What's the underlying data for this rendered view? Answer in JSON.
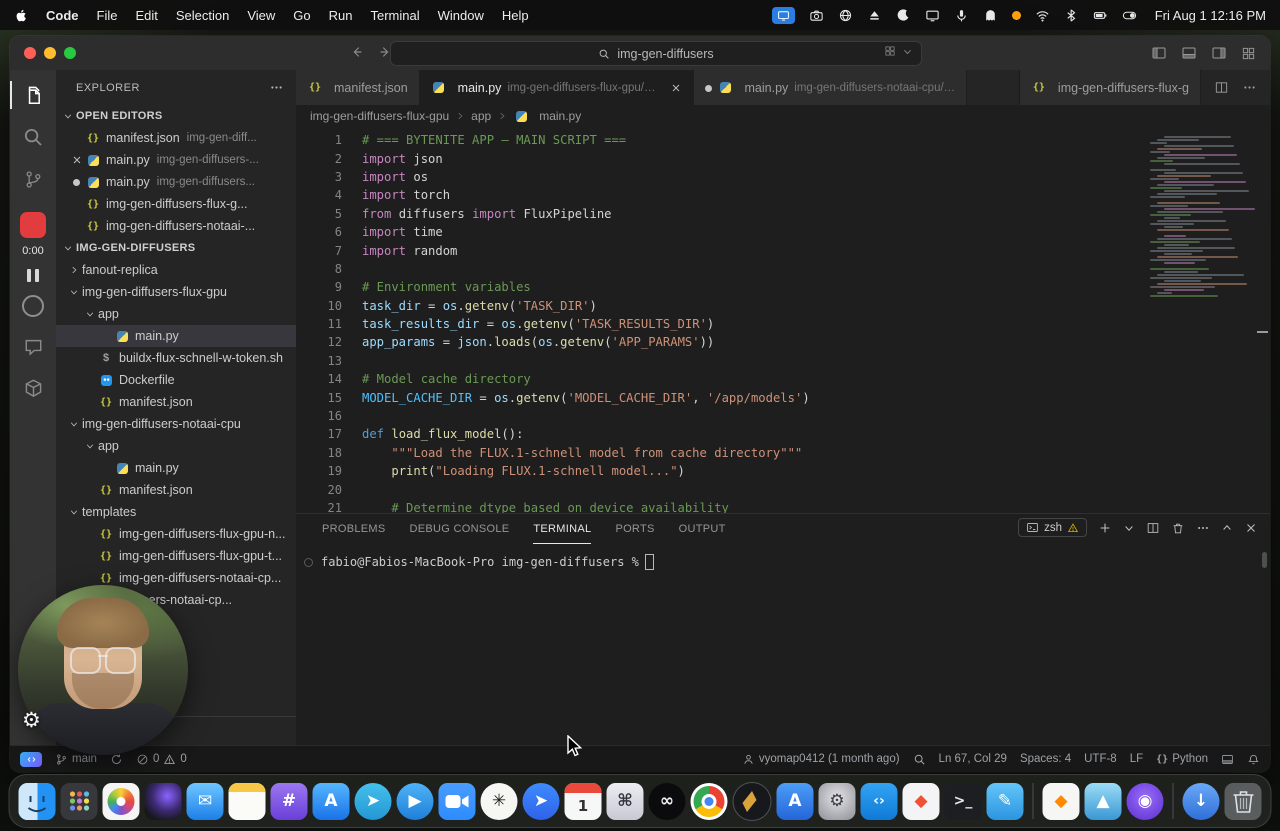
{
  "menubar": {
    "app_name": "Code",
    "menus": [
      "File",
      "Edit",
      "Selection",
      "View",
      "Go",
      "Run",
      "Terminal",
      "Window",
      "Help"
    ],
    "status_icons": [
      "screen-mirroring",
      "camera",
      "globe",
      "eject",
      "moon",
      "display",
      "mic",
      "ghost",
      "record-dot",
      "wifi",
      "bluetooth",
      "battery",
      "toggle"
    ],
    "clock": "Fri Aug 1 12:16 PM"
  },
  "titlebar": {
    "search_value": "img-gen-diffusers"
  },
  "recorder": {
    "time": "0:00"
  },
  "sidebar": {
    "title": "EXPLORER",
    "open_editors_label": "OPEN EDITORS",
    "open_editors": [
      {
        "icon": "json",
        "name": "manifest.json",
        "detail": "img-gen-diff...",
        "indicator": ""
      },
      {
        "icon": "python",
        "name": "main.py",
        "detail": "img-gen-diffusers-...",
        "indicator": "close"
      },
      {
        "icon": "python",
        "name": "main.py",
        "detail": "img-gen-diffusers...",
        "indicator": "dot"
      },
      {
        "icon": "json",
        "name": "img-gen-diffusers-flux-g...",
        "detail": "",
        "indicator": ""
      },
      {
        "icon": "json",
        "name": "img-gen-diffusers-notaai-...",
        "detail": "",
        "indicator": ""
      }
    ],
    "project_label": "IMG-GEN-DIFFUSERS",
    "tree": [
      {
        "indent": 0,
        "chevron": "collapsed",
        "icon": "",
        "name": "fanout-replica"
      },
      {
        "indent": 0,
        "chevron": "expanded",
        "icon": "",
        "name": "img-gen-diffusers-flux-gpu"
      },
      {
        "indent": 1,
        "chevron": "expanded",
        "icon": "",
        "name": "app"
      },
      {
        "indent": 2,
        "chevron": "",
        "icon": "python",
        "name": "main.py",
        "selected": true
      },
      {
        "indent": 1,
        "chevron": "",
        "icon": "shell",
        "name": "buildx-flux-schnell-w-token.sh"
      },
      {
        "indent": 1,
        "chevron": "",
        "icon": "docker",
        "name": "Dockerfile"
      },
      {
        "indent": 1,
        "chevron": "",
        "icon": "json",
        "name": "manifest.json"
      },
      {
        "indent": 0,
        "chevron": "expanded",
        "icon": "",
        "name": "img-gen-diffusers-notaai-cpu"
      },
      {
        "indent": 1,
        "chevron": "expanded",
        "icon": "",
        "name": "app"
      },
      {
        "indent": 2,
        "chevron": "",
        "icon": "python",
        "name": "main.py"
      },
      {
        "indent": 1,
        "chevron": "",
        "icon": "json",
        "name": "manifest.json"
      },
      {
        "indent": 0,
        "chevron": "expanded",
        "icon": "",
        "name": "templates"
      },
      {
        "indent": 1,
        "chevron": "",
        "icon": "json",
        "name": "img-gen-diffusers-flux-gpu-n..."
      },
      {
        "indent": 1,
        "chevron": "",
        "icon": "json",
        "name": "img-gen-diffusers-flux-gpu-t..."
      },
      {
        "indent": 1,
        "chevron": "",
        "icon": "json",
        "name": "img-gen-diffusers-notaai-cp..."
      },
      {
        "indent": 1,
        "chevron": "",
        "icon": "json",
        "name": "diffusers-notaai-cp..."
      }
    ]
  },
  "editor": {
    "tabs": [
      {
        "icon": "json",
        "title": "manifest.json",
        "state": "inactive",
        "close": false,
        "dirty": false
      },
      {
        "icon": "python",
        "title": "main.py",
        "detail": "img-gen-diffusers-flux-gpu/…",
        "state": "active",
        "close": true,
        "dirty": false
      },
      {
        "icon": "python",
        "title": "main.py",
        "detail": "img-gen-diffusers-notaai-cpu/…",
        "state": "inactive",
        "close": false,
        "dirty": true
      }
    ],
    "right_tab": {
      "icon": "json",
      "title": "img-gen-diffusers-flux-g"
    },
    "breadcrumb": [
      "img-gen-diffusers-flux-gpu",
      "app",
      "main.py"
    ],
    "code_lines": [
      {
        "n": "1",
        "s": [
          [
            "# === BYTENITE APP — MAIN SCRIPT ===",
            "c"
          ]
        ]
      },
      {
        "n": "2",
        "s": [
          [
            "import",
            "k"
          ],
          [
            " json",
            "p"
          ]
        ]
      },
      {
        "n": "3",
        "s": [
          [
            "import",
            "k"
          ],
          [
            " os",
            "p"
          ]
        ]
      },
      {
        "n": "4",
        "s": [
          [
            "import",
            "k"
          ],
          [
            " torch",
            "p"
          ]
        ]
      },
      {
        "n": "5",
        "s": [
          [
            "from",
            "k"
          ],
          [
            " diffusers ",
            "p"
          ],
          [
            "import",
            "k"
          ],
          [
            " FluxPipeline",
            "p"
          ]
        ]
      },
      {
        "n": "6",
        "s": [
          [
            "import",
            "k"
          ],
          [
            " time",
            "p"
          ]
        ]
      },
      {
        "n": "7",
        "s": [
          [
            "import",
            "k"
          ],
          [
            " random",
            "p"
          ]
        ]
      },
      {
        "n": "8",
        "s": []
      },
      {
        "n": "9",
        "s": [
          [
            "# Environment variables",
            "c"
          ]
        ]
      },
      {
        "n": "10",
        "s": [
          [
            "task_dir",
            "v"
          ],
          [
            " = ",
            "p"
          ],
          [
            "os",
            "v"
          ],
          [
            ".",
            "p"
          ],
          [
            "getenv",
            "f"
          ],
          [
            "(",
            "p"
          ],
          [
            "'TASK_DIR'",
            "s"
          ],
          [
            ")",
            "p"
          ]
        ]
      },
      {
        "n": "11",
        "s": [
          [
            "task_results_dir",
            "v"
          ],
          [
            " = ",
            "p"
          ],
          [
            "os",
            "v"
          ],
          [
            ".",
            "p"
          ],
          [
            "getenv",
            "f"
          ],
          [
            "(",
            "p"
          ],
          [
            "'TASK_RESULTS_DIR'",
            "s"
          ],
          [
            ")",
            "p"
          ]
        ]
      },
      {
        "n": "12",
        "s": [
          [
            "app_params",
            "v"
          ],
          [
            " = ",
            "p"
          ],
          [
            "json",
            "v"
          ],
          [
            ".",
            "p"
          ],
          [
            "loads",
            "f"
          ],
          [
            "(",
            "p"
          ],
          [
            "os",
            "v"
          ],
          [
            ".",
            "p"
          ],
          [
            "getenv",
            "f"
          ],
          [
            "(",
            "p"
          ],
          [
            "'APP_PARAMS'",
            "s"
          ],
          [
            "))",
            "p"
          ]
        ]
      },
      {
        "n": "13",
        "s": []
      },
      {
        "n": "14",
        "s": [
          [
            "# Model cache directory",
            "c"
          ]
        ]
      },
      {
        "n": "15",
        "s": [
          [
            "MODEL_CACHE_DIR",
            "C"
          ],
          [
            " = ",
            "p"
          ],
          [
            "os",
            "v"
          ],
          [
            ".",
            "p"
          ],
          [
            "getenv",
            "f"
          ],
          [
            "(",
            "p"
          ],
          [
            "'MODEL_CACHE_DIR'",
            "s"
          ],
          [
            ", ",
            "p"
          ],
          [
            "'/app/models'",
            "s"
          ],
          [
            ")",
            "p"
          ]
        ]
      },
      {
        "n": "16",
        "s": []
      },
      {
        "n": "17",
        "s": [
          [
            "def",
            "d"
          ],
          [
            " ",
            "p"
          ],
          [
            "load_flux_model",
            "f"
          ],
          [
            "():",
            "p"
          ]
        ]
      },
      {
        "n": "18",
        "s": [
          [
            "    \"\"\"Load the FLUX.1-schnell model from cache directory\"\"\"",
            "s"
          ]
        ]
      },
      {
        "n": "19",
        "s": [
          [
            "    ",
            "p"
          ],
          [
            "print",
            "f"
          ],
          [
            "(",
            "p"
          ],
          [
            "\"Loading FLUX.1-schnell model...\"",
            "s"
          ],
          [
            ")",
            "p"
          ]
        ]
      },
      {
        "n": "20",
        "s": []
      },
      {
        "n": "21",
        "s": [
          [
            "    # Determine dtype based on device availability",
            "c"
          ]
        ]
      }
    ]
  },
  "panel": {
    "tabs": [
      "PROBLEMS",
      "DEBUG CONSOLE",
      "TERMINAL",
      "PORTS",
      "OUTPUT"
    ],
    "active_tab": "TERMINAL",
    "shell_label": "zsh",
    "prompt": "fabio@Fabios-MacBook-Pro img-gen-diffusers %"
  },
  "statusbar": {
    "branch": "main",
    "errors": "0",
    "warnings": "0",
    "blame": "vyomap0412 (1 month ago)",
    "position": "Ln 67, Col 29",
    "indent": "Spaces: 4",
    "encoding": "UTF-8",
    "eol": "LF",
    "language": "Python"
  },
  "colors": {
    "recorder_red": "#e13c3e",
    "keyword": "#C586C0",
    "string": "#CE9178",
    "comment": "#6A9955",
    "function": "#DCDCAA",
    "variable": "#9CDCFE",
    "constant": "#4FC1FF",
    "selection_row": "#37373d"
  },
  "dock": {
    "items": [
      {
        "name": "finder",
        "kind": "finder"
      },
      {
        "name": "launchpad",
        "kind": "launchpad"
      },
      {
        "name": "photos",
        "kind": "photos"
      },
      {
        "name": "raycast",
        "kind": "plain",
        "bg": "radial-gradient(circle at 62% 35%, #8a63ff 0%, #3c2a73 45%, #17171c 78%)",
        "glyph": "",
        "fg": "#ffffff"
      },
      {
        "name": "mail",
        "kind": "plain",
        "bg": "linear-gradient(180deg,#6ec6ff,#1d7fe8)",
        "glyph": "✉",
        "fg": "#ffffff"
      },
      {
        "name": "notes",
        "kind": "notes"
      },
      {
        "name": "planner",
        "kind": "plain",
        "bg": "linear-gradient(180deg,#9a78f0,#6a3fd8)",
        "glyph": "#",
        "fg": "#ffffff"
      },
      {
        "name": "app-store",
        "kind": "plain",
        "bg": "linear-gradient(180deg,#55b6ff,#1a72e8)",
        "glyph": "A",
        "fg": "#ffffff"
      },
      {
        "name": "telegram",
        "kind": "plain",
        "bg": "linear-gradient(180deg,#45c0ec,#2397d3)",
        "glyph": "➤",
        "fg": "#ffffff",
        "round": "50%"
      },
      {
        "name": "video-call",
        "kind": "plain",
        "bg": "linear-gradient(180deg,#4fb3f6,#1f7fd9)",
        "glyph": "▶",
        "fg": "#ffffff",
        "round": "50%"
      },
      {
        "name": "zoom",
        "kind": "zoom"
      },
      {
        "name": "chatgpt",
        "kind": "plain",
        "bg": "#f6f6f2",
        "glyph": "✳",
        "fg": "#1f1f1f",
        "round": "50%"
      },
      {
        "name": "messenger",
        "kind": "plain",
        "bg": "linear-gradient(180deg,#3d8bff,#2f62e8)",
        "glyph": "➤",
        "fg": "#ffffff",
        "round": "50%"
      },
      {
        "name": "calendar",
        "kind": "calendar",
        "day": "1"
      },
      {
        "name": "dev-tool",
        "kind": "plain",
        "bg": "linear-gradient(180deg,#ececf2,#c9c9d4)",
        "glyph": "⌘",
        "fg": "#33363d"
      },
      {
        "name": "dark-circle-app",
        "kind": "plain",
        "bg": "#0b0b0d",
        "glyph": "∞",
        "fg": "#f2f2f2",
        "round": "50%"
      },
      {
        "name": "chrome",
        "kind": "chrome"
      },
      {
        "name": "compass-browser",
        "kind": "compass"
      },
      {
        "name": "docs-app",
        "kind": "plain",
        "bg": "linear-gradient(180deg,#4d9df7,#2465d8)",
        "glyph": "A",
        "fg": "#ffffff"
      },
      {
        "name": "system-settings",
        "kind": "plain",
        "bg": "radial-gradient(circle at 50% 40%, #e3e3e8, #8e8e96)",
        "glyph": "⚙",
        "fg": "#3c3c43"
      },
      {
        "name": "vscode",
        "kind": "plain",
        "bg": "linear-gradient(180deg,#33a3f2,#0f7ad8)",
        "glyph": "‹›",
        "fg": "#ffffff"
      },
      {
        "name": "git-client",
        "kind": "plain",
        "bg": "#f4f4f6",
        "glyph": "◆",
        "fg": "#f05033"
      },
      {
        "name": "terminal-app",
        "kind": "plain",
        "bg": "#1d1e22",
        "glyph": ">_",
        "fg": "#e8e8e8"
      },
      {
        "name": "design-app",
        "kind": "plain",
        "bg": "linear-gradient(180deg,#64c5f8,#2b95e0)",
        "glyph": "✎",
        "fg": "#ffffff"
      },
      {
        "kind": "sep"
      },
      {
        "name": "utility-app",
        "kind": "plain",
        "bg": "#f6f6f4",
        "glyph": "◆",
        "fg": "#ff8a00"
      },
      {
        "name": "media-app",
        "kind": "plain",
        "bg": "linear-gradient(180deg,#9bdcf6,#3a97d4)",
        "glyph": "▲",
        "fg": "#ffffff"
      },
      {
        "name": "recorder-app",
        "kind": "plain",
        "bg": "radial-gradient(circle at 50% 40%, #9a6ef8, #5b2fd0)",
        "glyph": "◉",
        "fg": "#ffffff",
        "round": "50%"
      },
      {
        "kind": "sep"
      },
      {
        "name": "downloads",
        "kind": "plain",
        "bg": "linear-gradient(180deg,#6aa9f7,#2f6fd8)",
        "glyph": "↓",
        "fg": "#ffffff",
        "round": "50%"
      },
      {
        "name": "trash",
        "kind": "trash"
      }
    ]
  }
}
